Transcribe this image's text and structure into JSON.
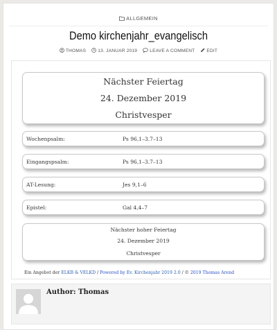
{
  "post": {
    "category": "ALLGEMEIN",
    "title": "Demo kirchenjahr_evangelisch",
    "meta": {
      "author": "THOMAS",
      "date": "13. JANUAR 2019",
      "comment": "LEAVE A COMMENT",
      "edit": "EDIT"
    }
  },
  "holiday": {
    "heading": "Nächster Feiertag",
    "date": "24. Dezember 2019",
    "name": "Christvesper"
  },
  "rows": [
    {
      "label": "Wochenpsalm:",
      "value": "Ps 96,1–3.7–13"
    },
    {
      "label": "Eingangspsalm:",
      "value": "Ps 96,1–3.7–13"
    },
    {
      "label": "AT-Lesung:",
      "value": "Jes 9,1–6"
    },
    {
      "label": "Epistel:",
      "value": "Gal 4,4–7"
    }
  ],
  "high_holiday": {
    "heading": "Nächster hoher Feiertag",
    "date": "24. Dezember 2019",
    "name": "Christvesper"
  },
  "footer": {
    "prefix": "Ein Angebot der ",
    "link1": "ELKB & VELKD",
    "sep1": " / ",
    "link2": "Powered by",
    "link3": " Ev. Kirchenjahr 2019 2.0",
    "sep2": " / © ",
    "link4": "2019 Thomas Arend"
  },
  "author_box": {
    "label": "Author: Thomas"
  },
  "colors": {
    "link": "#2a5db0",
    "link_dark": "#2a4fc8",
    "background": "#eceae6"
  }
}
